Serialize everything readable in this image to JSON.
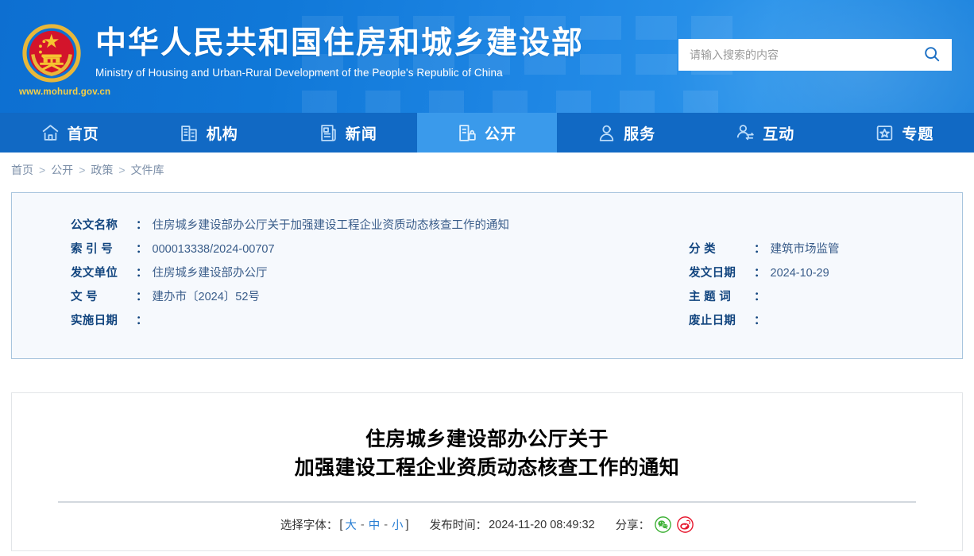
{
  "header": {
    "title_cn": "中华人民共和国住房和城乡建设部",
    "title_en": "Ministry of Housing and Urban-Rural Development of the People's Republic of China",
    "url": "www.mohurd.gov.cn",
    "emblem_alt": "national-emblem",
    "colors": {
      "banner_blue": "#1078d8",
      "nav_blue": "#1169c4",
      "active_blue": "#3a9aeb",
      "url_gold": "#f7d046"
    }
  },
  "search": {
    "placeholder": "请输入搜索的内容",
    "value": "",
    "button_label": ""
  },
  "nav": {
    "items": [
      {
        "label": "首页",
        "icon": "home-icon",
        "active": false
      },
      {
        "label": "机构",
        "icon": "building-icon",
        "active": false
      },
      {
        "label": "新闻",
        "icon": "news-icon",
        "active": false
      },
      {
        "label": "公开",
        "icon": "open-document-icon",
        "active": true
      },
      {
        "label": "服务",
        "icon": "person-service-icon",
        "active": false
      },
      {
        "label": "互动",
        "icon": "person-exchange-icon",
        "active": false
      },
      {
        "label": "专题",
        "icon": "star-card-icon",
        "active": false
      }
    ]
  },
  "breadcrumb": {
    "items": [
      "首页",
      "公开",
      "政策",
      "文件库"
    ],
    "separator": ">"
  },
  "meta": {
    "left": [
      {
        "label": "公文名称",
        "colon": "：",
        "value": "住房城乡建设部办公厅关于加强建设工程企业资质动态核查工作的通知"
      },
      {
        "label": "索 引 号",
        "colon": "：",
        "value": "000013338/2024-00707"
      },
      {
        "label": "发文单位",
        "colon": "：",
        "value": "住房城乡建设部办公厅"
      },
      {
        "label": "文    号",
        "colon": "：",
        "value": "建办市〔2024〕52号"
      },
      {
        "label": "实施日期",
        "colon": "：",
        "value": ""
      }
    ],
    "right": [
      {
        "label": "分    类",
        "colon": "：",
        "value": "建筑市场监管"
      },
      {
        "label": "发文日期",
        "colon": "：",
        "value": "2024-10-29"
      },
      {
        "label": "主 题 词",
        "colon": "：",
        "value": ""
      },
      {
        "label": "废止日期",
        "colon": "：",
        "value": ""
      }
    ]
  },
  "article": {
    "title_line1": "住房城乡建设部办公厅关于",
    "title_line2": "加强建设工程企业资质动态核查工作的通知",
    "toolbar": {
      "font_label": "选择字体：",
      "bracket_open": "[",
      "bracket_close": "]",
      "font_large": "大",
      "font_medium": "中",
      "font_small": "小",
      "dash": "-",
      "publish_label": "发布时间：",
      "publish_time": "2024-11-20 08:49:32",
      "share_label": "分享：",
      "share_items": [
        {
          "name": "wechat-share-icon",
          "color": "#3cb034"
        },
        {
          "name": "weibo-share-icon",
          "color": "#e6162d"
        }
      ]
    }
  }
}
